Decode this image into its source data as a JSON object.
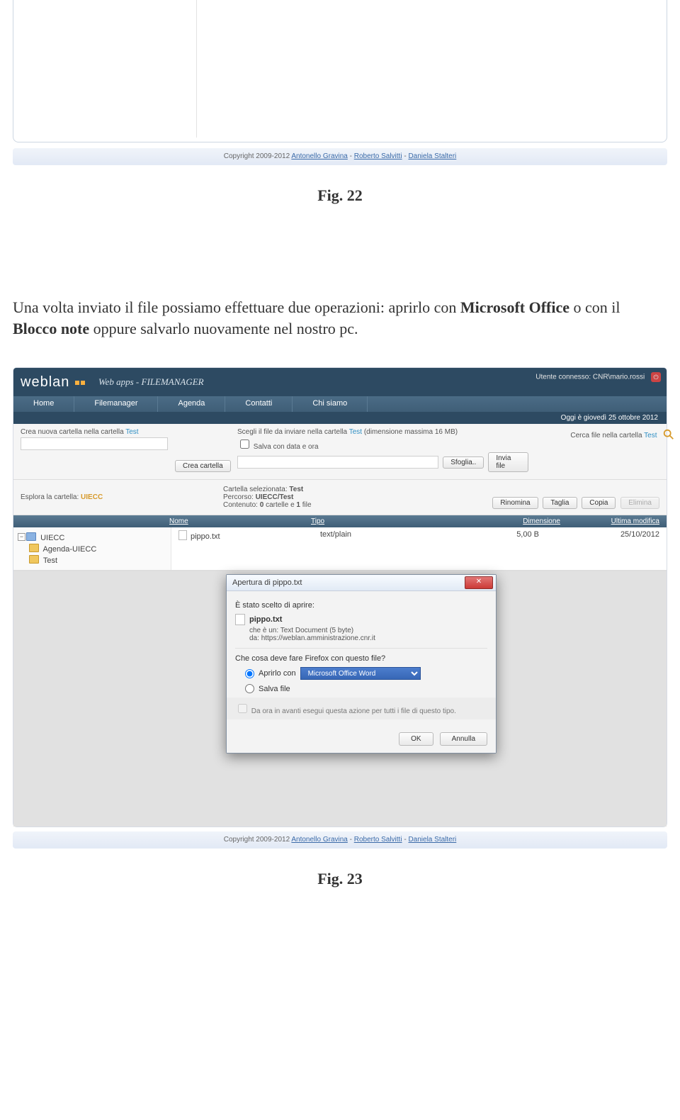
{
  "fig22": {
    "copyright_prefix": "Copyright 2009-2012 ",
    "authors": [
      "Antonello Gravina",
      "Roberto Salvitti",
      "Daniela Stalteri"
    ],
    "sep": " - ",
    "caption": "Fig. 22"
  },
  "body_paragraph": {
    "t1": "Una volta inviato il file possiamo effettuare due operazioni: aprirlo con ",
    "b1": "Microsoft Office",
    "t2": " o con il ",
    "b2": "Blocco note",
    "t3": " oppure salvarlo nuovamente nel nostro pc."
  },
  "app": {
    "logo_text": "weblan",
    "banner_sub": "Web apps - FILEMANAGER",
    "user_label": "Utente connesso: ",
    "user_value": "CNR\\mario.rossi",
    "menu": [
      "Home",
      "Filemanager",
      "Agenda",
      "Contatti",
      "Chi siamo"
    ],
    "datebar": "Oggi è giovedì 25 ottobre 2012",
    "create": {
      "label_prefix": "Crea nuova cartella nella cartella ",
      "folder": "Test",
      "btn": "Crea cartella"
    },
    "upload": {
      "label_prefix": "Scegli il file da inviare nella cartella ",
      "folder": "Test",
      "label_suffix": " (dimensione massima 16 MB)",
      "save_date": "Salva con data e ora",
      "browse": "Sfoglia..",
      "send": "Invia file"
    },
    "search": {
      "label_prefix": "Cerca file nella cartella ",
      "folder": "Test"
    },
    "explore": {
      "label": "Esplora la cartella: ",
      "value": "UIECC"
    },
    "folderinfo": {
      "sel_prefix": "Cartella selezionata: ",
      "sel_value": "Test",
      "path_prefix": "Percorso: ",
      "path_value": "UIECC/Test",
      "content_prefix": "Contenuto: ",
      "content_value_1": "0",
      "content_label_1": " cartelle e ",
      "content_value_2": "1",
      "content_label_2": " file"
    },
    "actions": {
      "rename": "Rinomina",
      "cut": "Taglia",
      "copy": "Copia",
      "delete": "Elimina"
    },
    "columns": {
      "name": "Nome",
      "type": "Tipo",
      "size": "Dimensione",
      "mod": "Ultima modifica"
    },
    "tree": {
      "root": "UIECC",
      "agenda": "Agenda-UIECC",
      "test": "Test"
    },
    "row": {
      "name": "pippo.txt",
      "type": "text/plain",
      "size": "5,00 B",
      "mod": "25/10/2012"
    }
  },
  "dialog": {
    "title": "Apertura di pippo.txt",
    "chosen": "È stato scelto di aprire:",
    "fname": "pippo.txt",
    "kind_prefix": "che è un: ",
    "kind_value": "Text Document (5 byte)",
    "from_prefix": "da: ",
    "from_value": "https://weblan.amministrazione.cnr.it",
    "question": "Che cosa deve fare Firefox con questo file?",
    "open_with": "Aprirlo con",
    "app_option": "Microsoft Office Word",
    "save": "Salva file",
    "remember": "Da ora in avanti esegui questa azione per tutti i file di questo tipo.",
    "ok": "OK",
    "cancel": "Annulla"
  },
  "fig23": {
    "copyright_prefix": "Copyright 2009-2012 ",
    "authors": [
      "Antonello Gravina",
      "Roberto Salvitti",
      "Daniela Stalteri"
    ],
    "sep": " - ",
    "caption": "Fig. 23"
  }
}
